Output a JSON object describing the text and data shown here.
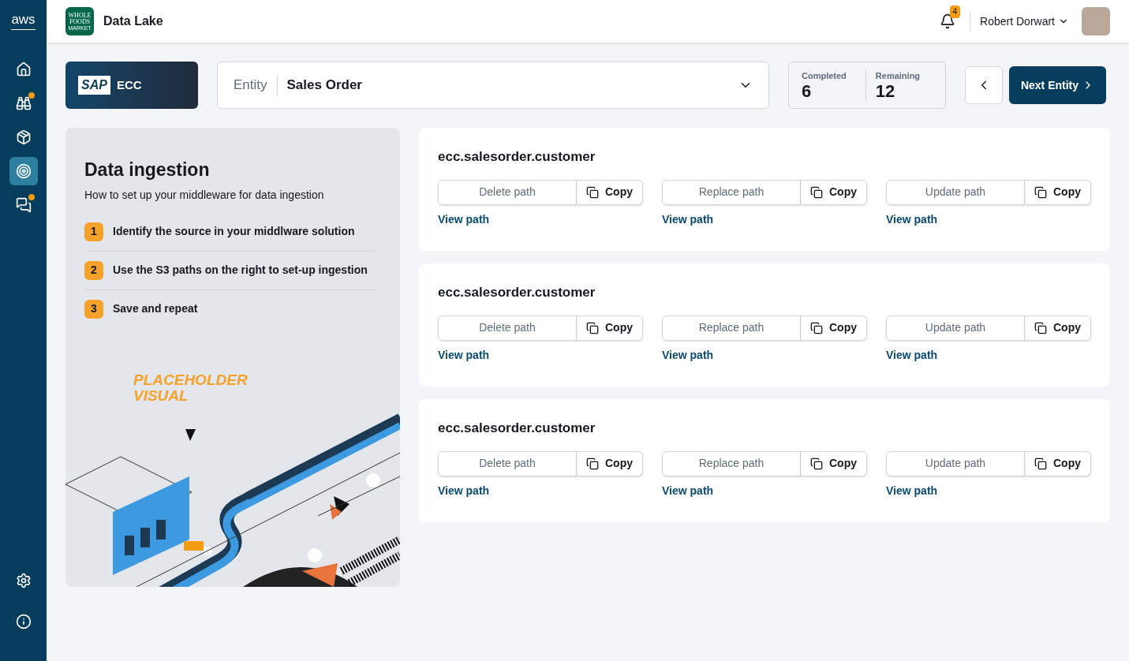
{
  "sidebar": {
    "logo": "aws",
    "items": [
      {
        "selected": false,
        "dot": false
      },
      {
        "selected": false,
        "dot": true
      },
      {
        "selected": false,
        "dot": false
      },
      {
        "selected": true,
        "dot": false
      },
      {
        "selected": false,
        "dot": true
      }
    ]
  },
  "header": {
    "brand_logo": [
      "WHOLE",
      "FOODS",
      "MARKET"
    ],
    "app_title": "Data Lake",
    "notifications": "4",
    "user_name": "Robert Dorwart"
  },
  "source": {
    "logo": "SAP",
    "name": "ECC"
  },
  "entity": {
    "label": "Entity",
    "value": "Sales Order"
  },
  "progress": [
    {
      "label": "Completed",
      "value": "6"
    },
    {
      "label": "Remaining",
      "value": "12"
    }
  ],
  "next_button": "Next Entity",
  "guide": {
    "title": "Data ingestion",
    "subtitle": "How to set up your middleware for data ingestion",
    "steps": [
      {
        "number": "1",
        "text": "Identify the source in your middlware solution"
      },
      {
        "number": "2",
        "text": "Use the S3 paths on the right to set-up ingestion"
      },
      {
        "number": "3",
        "text": "Save and repeat"
      }
    ],
    "visual_label": [
      "PLACEHOLDER",
      "VISUAL"
    ]
  },
  "cards": [
    {
      "title": "ecc.salesorder.customer",
      "paths": [
        {
          "placeholder": "Delete path",
          "action": "Copy",
          "link": "View path"
        },
        {
          "placeholder": "Replace path",
          "action": "Copy",
          "link": "View path"
        },
        {
          "placeholder": "Update path",
          "action": "Copy",
          "link": "View path"
        }
      ]
    },
    {
      "title": "ecc.salesorder.customer",
      "paths": [
        {
          "placeholder": "Delete path",
          "action": "Copy",
          "link": "View path"
        },
        {
          "placeholder": "Replace path",
          "action": "Copy",
          "link": "View path"
        },
        {
          "placeholder": "Update path",
          "action": "Copy",
          "link": "View path"
        }
      ]
    },
    {
      "title": "ecc.salesorder.customer",
      "paths": [
        {
          "placeholder": "Delete path",
          "action": "Copy",
          "link": "View path"
        },
        {
          "placeholder": "Replace path",
          "action": "Copy",
          "link": "View path"
        },
        {
          "placeholder": "Update path",
          "action": "Copy",
          "link": "View path"
        }
      ]
    }
  ]
}
